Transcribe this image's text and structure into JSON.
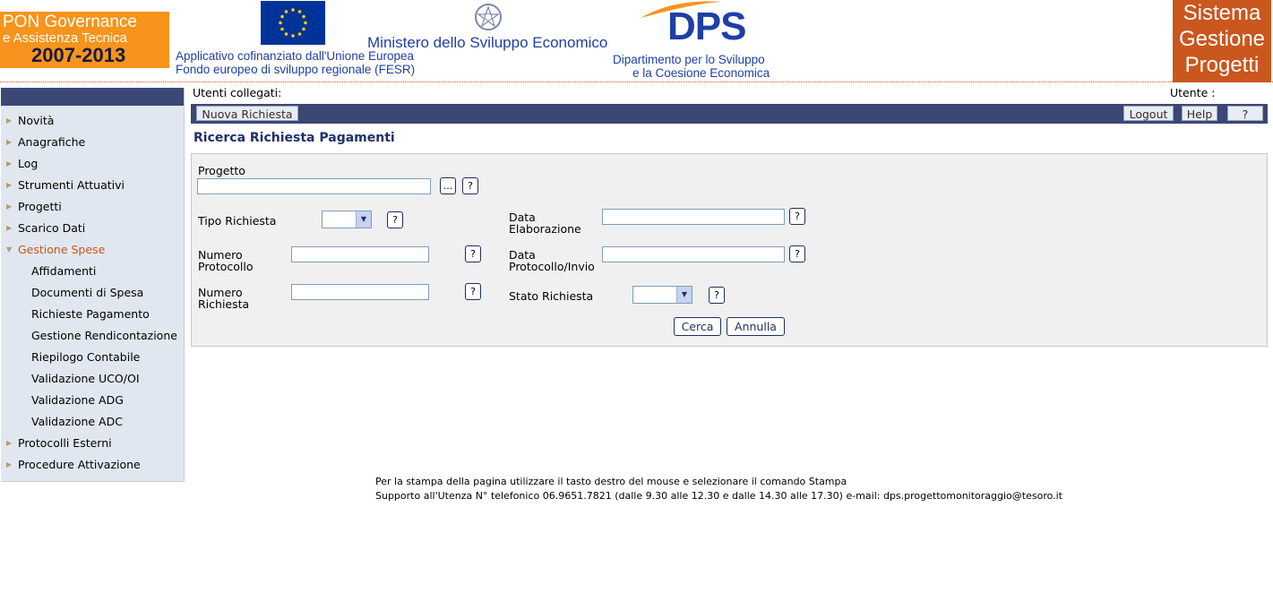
{
  "header": {
    "pon_logo": {
      "line1": "PON Governance",
      "line2": "e Assistenza Tecnica",
      "line3": "2007-2013"
    },
    "cofinanziato_line1": "Applicativo cofinanziato dall'Unione Europea",
    "cofinanziato_line2": "Fondo europeo di sviluppo regionale (FESR)",
    "ministero": "Ministero dello Sviluppo Economico",
    "dps_logo_text": "DPS",
    "dps_line1": "Dipartimento per lo Sviluppo",
    "dps_line2": "e la Coesione Economica",
    "sgp_logo": {
      "line1": "Sistema",
      "line2": "Gestione",
      "line3": "Progetti"
    }
  },
  "status_bar": {
    "users_connected_label": "Utenti collegati:",
    "user_label": "Utente :"
  },
  "toolbar": {
    "new_request": "Nuova Richiesta",
    "logout": "Logout",
    "help": "Help",
    "question": "?"
  },
  "sidebar": {
    "items": [
      {
        "label": "Novità"
      },
      {
        "label": "Anagrafiche"
      },
      {
        "label": "Log"
      },
      {
        "label": "Strumenti Attuativi"
      },
      {
        "label": "Progetti"
      },
      {
        "label": "Scarico Dati"
      },
      {
        "label": "Gestione Spese"
      },
      {
        "label": "Affidamenti"
      },
      {
        "label": "Documenti di Spesa"
      },
      {
        "label": "Richieste Pagamento"
      },
      {
        "label": "Gestione Rendicontazione"
      },
      {
        "label": "Riepilogo Contabile"
      },
      {
        "label": "Validazione UCO/OI"
      },
      {
        "label": "Validazione ADG"
      },
      {
        "label": "Validazione ADC"
      },
      {
        "label": "Protocolli Esterni"
      },
      {
        "label": "Procedure Attivazione"
      }
    ]
  },
  "page": {
    "title": "Ricerca Richiesta Pagamenti"
  },
  "form": {
    "progetto_label": "Progetto",
    "progetto_value": "",
    "browse_button": "...",
    "help_button": "?",
    "tipo_richiesta_label": "Tipo Richiesta",
    "tipo_richiesta_value": "",
    "data_elaborazione_label_1": "Data",
    "data_elaborazione_label_2": "Elaborazione",
    "data_elaborazione_value": "",
    "numero_protocollo_label_1": "Numero",
    "numero_protocollo_label_2": "Protocollo",
    "numero_protocollo_value": "",
    "data_protocollo_label_1": "Data",
    "data_protocollo_label_2": "Protocollo/Invio",
    "data_protocollo_value": "",
    "numero_richiesta_label_1": "Numero",
    "numero_richiesta_label_2": "Richiesta",
    "numero_richiesta_value": "",
    "stato_richiesta_label": "Stato Richiesta",
    "stato_richiesta_value": "",
    "search_button": "Cerca",
    "cancel_button": "Annulla"
  },
  "footer": {
    "line1": "Per la stampa della pagina utilizzare il tasto destro del mouse e selezionare il comando Stampa",
    "line2": "Supporto all'Utenza N° telefonico 06.9651.7821 (dalle 9.30 alle 12.30 e dalle 14.30 alle 17.30) e-mail: dps.progettomonitoraggio@tesoro.it"
  },
  "colors": {
    "nav_dark": "#3b4774",
    "accent_orange": "#c9571e",
    "pon_orange": "#f7941d",
    "title_blue": "#1f2f6a",
    "sidebar_bg": "#e1e7f0"
  },
  "icons": {
    "sidebar_bullet": "right-arrow-icon",
    "select": "chevron-down-icon"
  }
}
